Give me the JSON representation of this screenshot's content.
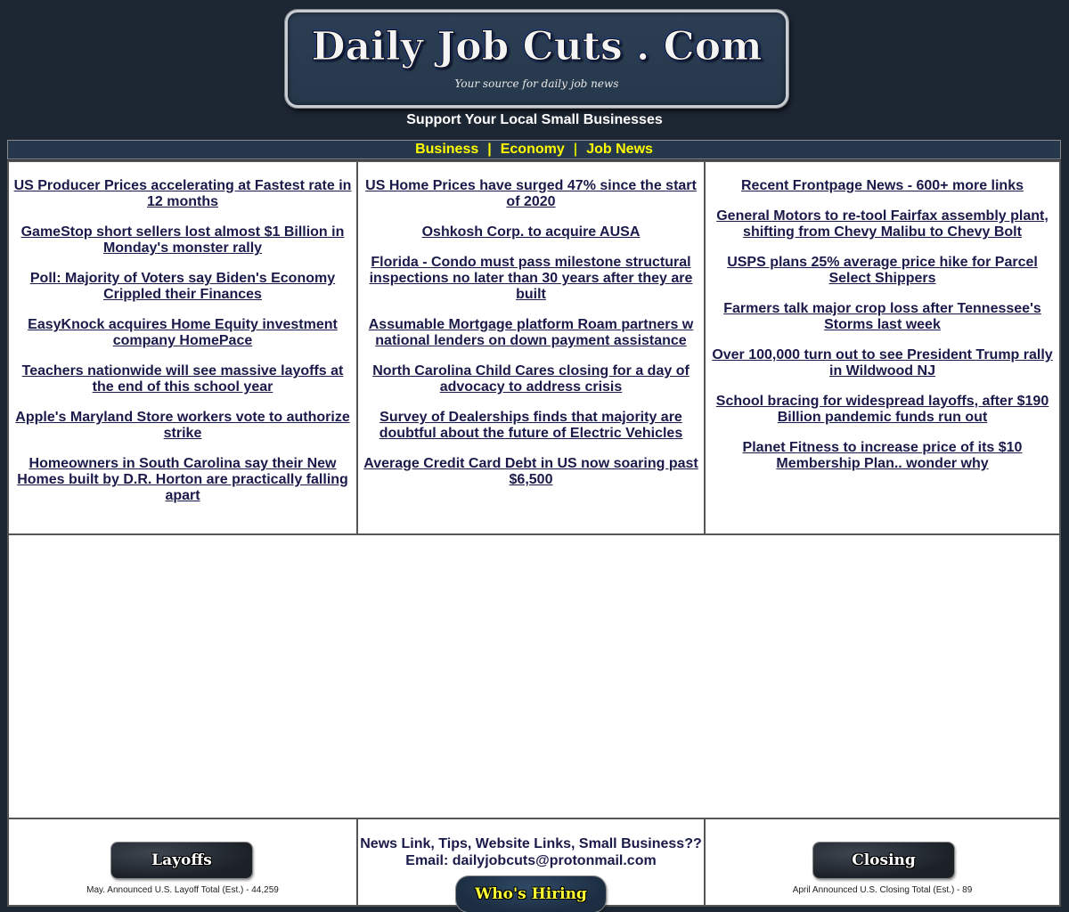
{
  "header": {
    "logo_title": "Daily Job Cuts . Com",
    "logo_tagline": "Your source for daily job news",
    "support_text": "Support Your Local Small Businesses"
  },
  "nav": {
    "items": [
      {
        "label": "Business"
      },
      {
        "label": "Economy"
      },
      {
        "label": "Job News"
      }
    ],
    "separator": "|"
  },
  "colors": {
    "page_bg": "#1d2633",
    "nav_bg": "#26384b",
    "nav_text": "#ffff00",
    "link": "#1a1a4a",
    "cell_bg": "#ffffff"
  },
  "news": {
    "col1": [
      "US Producer Prices accelerating at Fastest rate in 12 months",
      "GameStop short sellers lost almost $1 Billion in Monday's monster rally",
      "Poll: Majority of Voters say Biden's Economy Crippled their Finances",
      "EasyKnock acquires Home Equity investment company HomePace",
      "Teachers nationwide will see massive layoffs at the end of this school year",
      "Apple's Maryland Store workers vote to authorize strike",
      "Homeowners in South Carolina say their New Homes built by D.R. Horton are practically falling apart"
    ],
    "col2": [
      "US Home Prices have surged 47% since the start of 2020",
      "Oshkosh Corp. to acquire AUSA",
      "Florida - Condo must pass milestone structural inspections no later than 30 years after they are built",
      "Assumable Mortgage platform Roam partners w national lenders on down payment assistance",
      "North Carolina Child Cares closing for a day of advocacy to address crisis",
      "Survey of Dealerships finds that majority are doubtful about the future of Electric Vehicles",
      "Average Credit Card Debt in US now soaring past $6,500"
    ],
    "col3": [
      "Recent Frontpage News - 600+ more links",
      "General Motors to re-tool Fairfax assembly plant, shifting from Chevy Malibu to Chevy Bolt",
      "USPS plans 25% average price hike for Parcel Select Shippers",
      "Farmers talk major crop loss after Tennessee's Storms last week",
      "Over 100,000 turn out to see President Trump rally in Wildwood NJ",
      "School bracing for widespread layoffs, after $190 Billion pandemic funds run out",
      "Planet Fitness to increase price of its $10 Membership Plan.. wonder why"
    ]
  },
  "bottom": {
    "layoffs_button": "Layoffs",
    "layoffs_stat": "May. Announced U.S. Layoff Total (Est.) - 44,259",
    "contact_line1": "News Link, Tips, Website Links, Small Business??",
    "contact_line2": "Email: dailyjobcuts@protonmail.com",
    "hiring_button": "Who's Hiring",
    "closing_button": "Closing",
    "closing_stat": "April Announced U.S. Closing Total (Est.) - 89"
  }
}
